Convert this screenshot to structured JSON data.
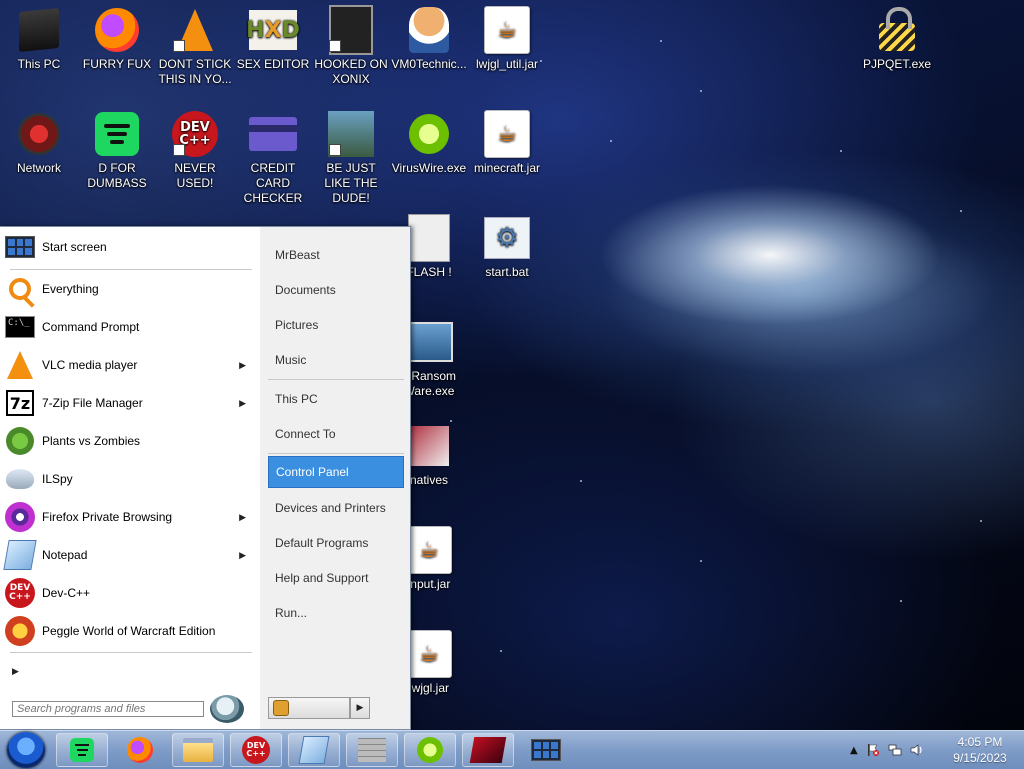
{
  "desktop": {
    "icons_row1": [
      {
        "label": "This PC",
        "icon": "this-pc-icon"
      },
      {
        "label": "FURRY FUX",
        "icon": "firefox-icon"
      },
      {
        "label": "DONT STICK THIS IN YO...",
        "icon": "vlc-cone-icon"
      },
      {
        "label": "SEX EDITOR",
        "icon": "hxd-icon"
      },
      {
        "label": "HOOKED ON XONIX",
        "icon": "xonix-icon"
      },
      {
        "label": "VM0Technic...",
        "icon": "doctor-icon"
      },
      {
        "label": "lwjgl_util.jar",
        "icon": "java-icon"
      },
      {
        "label": "PJPQET.exe",
        "icon": "padlock-icon"
      }
    ],
    "icons_row2": [
      {
        "label": "Network",
        "icon": "network-icon"
      },
      {
        "label": "D FOR DUMBASS",
        "icon": "spotify-icon"
      },
      {
        "label": "NEVER USED!",
        "icon": "dev-cpp-icon",
        "glyph": "DEV C++"
      },
      {
        "label": "CREDIT CARD CHECKER",
        "icon": "credit-card-icon"
      },
      {
        "label": "BE JUST LIKE THE DUDE!",
        "icon": "dude-icon"
      },
      {
        "label": "VirusWire.exe",
        "icon": "limewire-icon"
      },
      {
        "label": "minecraft.jar",
        "icon": "java-icon"
      }
    ],
    "icons_partial": [
      {
        "label": "FLASH !",
        "icon": "flash-icon"
      },
      {
        "label": "start.bat",
        "icon": "batch-gear-icon"
      },
      {
        "label": "y Ransom Ware.exe",
        "icon": "ransomware-icon"
      },
      {
        "label": "natives",
        "icon": "natives-icon"
      },
      {
        "label": "input.jar",
        "icon": "java-icon"
      },
      {
        "label": "lwjgl.jar",
        "icon": "java-icon"
      }
    ]
  },
  "start_menu": {
    "left_items": [
      {
        "label": "Start screen",
        "icon": "start-screen-icon",
        "submenu": false
      },
      {
        "label": "Everything",
        "icon": "everything-search-icon",
        "submenu": false
      },
      {
        "label": "Command Prompt",
        "icon": "command-prompt-icon",
        "submenu": false
      },
      {
        "label": "VLC media player",
        "icon": "vlc-icon",
        "submenu": true
      },
      {
        "label": "7-Zip File Manager",
        "icon": "seven-zip-icon",
        "submenu": true
      },
      {
        "label": "Plants vs Zombies",
        "icon": "plants-vs-zombies-icon",
        "submenu": false
      },
      {
        "label": "ILSpy",
        "icon": "ilspy-icon",
        "submenu": false
      },
      {
        "label": "Firefox Private Browsing",
        "icon": "firefox-private-icon",
        "submenu": true
      },
      {
        "label": "Notepad",
        "icon": "notepad-icon",
        "submenu": true
      },
      {
        "label": "Dev-C++",
        "icon": "dev-cpp-icon",
        "submenu": false
      },
      {
        "label": "Peggle World of Warcraft Edition",
        "icon": "peggle-icon",
        "submenu": false
      }
    ],
    "glyphs": {
      "cmd": "C:\\_",
      "seven_zip": "7z",
      "dev": "DEV C++",
      "submenu_arrow": "▶"
    },
    "search": {
      "placeholder": "Search programs and files",
      "value": ""
    },
    "right_items": [
      {
        "label": "MrBeast"
      },
      {
        "label": "Documents"
      },
      {
        "label": "Pictures"
      },
      {
        "label": "Music"
      },
      {
        "label": "This PC"
      },
      {
        "label": "Connect To"
      },
      {
        "label": "Control Panel",
        "highlighted": true
      },
      {
        "label": "Devices and Printers"
      },
      {
        "label": "Default Programs"
      },
      {
        "label": "Help and Support"
      },
      {
        "label": "Run..."
      }
    ],
    "shutdown_arrow": "▶"
  },
  "taskbar": {
    "items": [
      {
        "icon": "spotify-icon"
      },
      {
        "icon": "firefox-icon"
      },
      {
        "icon": "file-explorer-icon"
      },
      {
        "icon": "dev-cpp-icon",
        "glyph": "DEV C++"
      },
      {
        "icon": "notepad-icon"
      },
      {
        "icon": "wall-icon"
      },
      {
        "icon": "limewire-icon"
      },
      {
        "icon": "red-app-icon"
      },
      {
        "icon": "start-screen-icon"
      }
    ],
    "tray": {
      "expand_arrow": "▲"
    },
    "clock": {
      "time": "4:05 PM",
      "date": "9/15/2023"
    }
  },
  "colors": {
    "menu_highlight": "#3a8fe0",
    "taskbar": "#7f9cc8"
  }
}
